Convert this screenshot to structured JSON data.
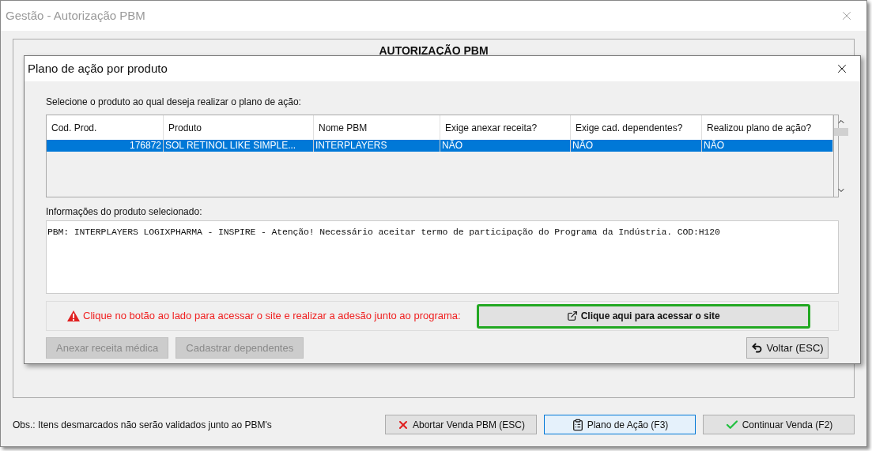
{
  "window": {
    "title": "Gestão - Autorização PBM"
  },
  "panel": {
    "title": "AUTORIZAÇÃO PBM"
  },
  "dialog": {
    "title": "Plano de ação por produto",
    "prompt": "Selecione o produto ao qual deseja realizar o plano de ação:",
    "table": {
      "columns": [
        "Cod. Prod.",
        "Produto",
        "Nome PBM",
        "Exige anexar receita?",
        "Exige cad. dependentes?",
        "Realizou plano de ação?"
      ],
      "rows": [
        {
          "selected": true,
          "cells": [
            "176872",
            "SOL RETINOL LIKE SIMPLE...",
            "INTERPLAYERS",
            "NÃO",
            "NÃO",
            "NÃO"
          ]
        }
      ]
    },
    "info_label": "Informações do produto selecionado:",
    "info_text": "PBM: INTERPLAYERS LOGIXPHARMA - INSPIRE - Atenção! Necessário aceitar termo de participação do Programa da Indústria. COD:H120",
    "warning": "Clique no botão ao lado para acessar o site e realizar a adesão junto ao programa:",
    "site_button": "Clique aqui para acessar o site",
    "actions": [
      {
        "label": "Anexar receita médica",
        "disabled": true
      },
      {
        "label": "Cadastrar dependentes",
        "disabled": true
      }
    ],
    "back_button": "Voltar (ESC)"
  },
  "footer": {
    "note": "Obs.: Itens desmarcados não serão validados junto ao PBM's",
    "buttons": [
      {
        "kind": "abort",
        "label": "Abortar Venda PBM (ESC)",
        "selected": false
      },
      {
        "kind": "plan",
        "label": "Plano de Ação (F3)",
        "selected": true
      },
      {
        "kind": "continue",
        "label": "Continuar Venda (F2)",
        "selected": false
      }
    ]
  }
}
